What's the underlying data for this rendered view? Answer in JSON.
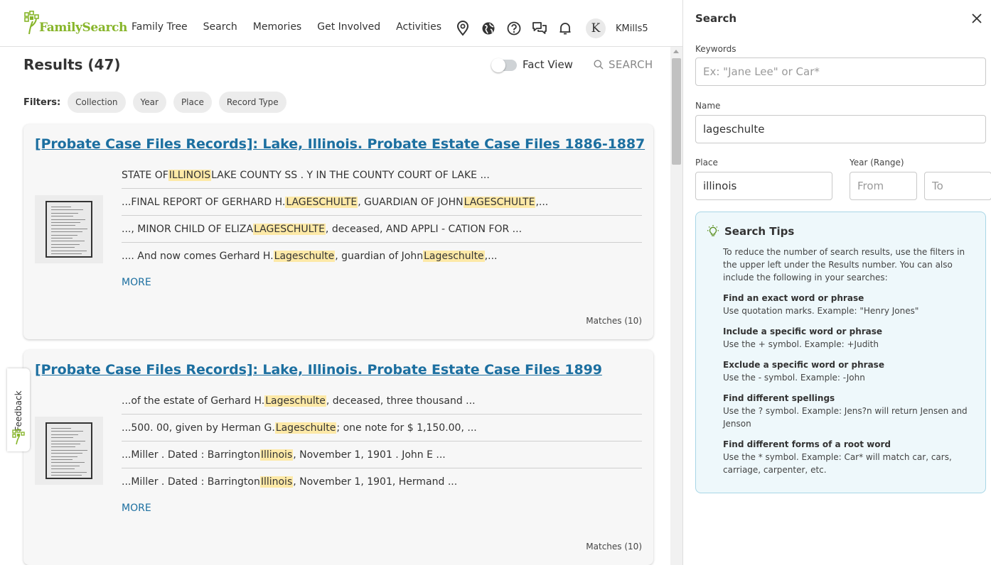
{
  "header": {
    "logo_text": "FamilySearch",
    "nav": [
      "Family Tree",
      "Search",
      "Memories",
      "Get Involved",
      "Activities"
    ],
    "avatar_initial": "K",
    "username": "KMills5"
  },
  "results": {
    "title": "Results (47)",
    "fact_view_label": "Fact View",
    "search_link": "SEARCH",
    "filters_label": "Filters:",
    "filters": [
      "Collection",
      "Year",
      "Place",
      "Record Type"
    ]
  },
  "records": [
    {
      "title": "[Probate Case Files Records]: Lake, Illinois. Probate Estate Case Files 1886-1887",
      "snippets": [
        [
          {
            "t": "STATE OF "
          },
          {
            "t": "ILLINOIS",
            "h": true
          },
          {
            "t": " LAKE COUNTY SS . Y IN THE COUNTY COURT OF LAKE ..."
          }
        ],
        [
          {
            "t": "...FINAL REPORT OF GERHARD H. "
          },
          {
            "t": "LAGESCHULTE",
            "h": true
          },
          {
            "t": ", GUARDIAN OF JOHN "
          },
          {
            "t": "LAGESCHULTE",
            "h": true
          },
          {
            "t": ",..."
          }
        ],
        [
          {
            "t": "..., MINOR CHILD OF ELIZA "
          },
          {
            "t": "LAGESCHULTE",
            "h": true
          },
          {
            "t": ", deceased, AND APPLI - CATION FOR ..."
          }
        ],
        [
          {
            "t": ".... And now comes Gerhard H. "
          },
          {
            "t": "Lageschulte",
            "h": true
          },
          {
            "t": ", guardian of John "
          },
          {
            "t": "Lageschulte",
            "h": true
          },
          {
            "t": ",..."
          }
        ]
      ],
      "more": "MORE",
      "matches": "Matches (10)"
    },
    {
      "title": "[Probate Case Files Records]: Lake, Illinois. Probate Estate Case Files 1899",
      "snippets": [
        [
          {
            "t": "...of the estate of Gerhard H. "
          },
          {
            "t": "Lageschulte",
            "h": true
          },
          {
            "t": ", deceased, three thousand ..."
          }
        ],
        [
          {
            "t": "...500. 00, given by Herman G. "
          },
          {
            "t": "Lageschulte",
            "h": true
          },
          {
            "t": " ; one note for $ 1,150.00, ..."
          }
        ],
        [
          {
            "t": "...Miller . Dated : Barrington "
          },
          {
            "t": "Illinois",
            "h": true
          },
          {
            "t": ", November 1, 1901 . John E ..."
          }
        ],
        [
          {
            "t": "...Miller . Dated : Barrington "
          },
          {
            "t": "Illinois",
            "h": true
          },
          {
            "t": ", November 1, 1901, Hermand ..."
          }
        ]
      ],
      "more": "MORE",
      "matches": "Matches (10)"
    }
  ],
  "feedback": {
    "label": "Feedback"
  },
  "search_panel": {
    "title": "Search",
    "keywords_label": "Keywords",
    "keywords_placeholder": "Ex: \"Jane Lee\" or Car*",
    "keywords_value": "",
    "name_label": "Name",
    "name_value": "lageschulte",
    "place_label": "Place",
    "place_value": "illinois",
    "year_label": "Year (Range)",
    "from_placeholder": "From",
    "to_placeholder": "To"
  },
  "tips": {
    "title": "Search Tips",
    "intro": "To reduce the number of search results, use the filters in the upper left under the Results number. You can also include the following in your searches:",
    "items": [
      {
        "heading": "Find an exact word or phrase",
        "text": "Use quotation marks. Example: \"Henry Jones\""
      },
      {
        "heading": "Include a specific word or phrase",
        "text": "Use the + symbol. Example: +Judith"
      },
      {
        "heading": "Exclude a specific word or phrase",
        "text": "Use the - symbol. Example: -John"
      },
      {
        "heading": "Find different spellings",
        "text": "Use the ? symbol. Example: Jens?n will return Jensen and Jenson"
      },
      {
        "heading": "Find different forms of a root word",
        "text": "Use the * symbol. Example: Car* will match car, cars, carriage, carpenter, etc."
      }
    ]
  },
  "colors": {
    "brand_green": "#87b52a",
    "link_blue": "#1c6fa0",
    "highlight": "#fde9a7",
    "tips_bg": "#eef8fb",
    "tips_border": "#a8d6e6"
  },
  "icons": [
    "pin-icon",
    "globe-icon",
    "help-icon",
    "chat-icon",
    "bell-icon",
    "search-icon",
    "close-icon",
    "lightbulb-icon",
    "tree-logo-icon"
  ]
}
